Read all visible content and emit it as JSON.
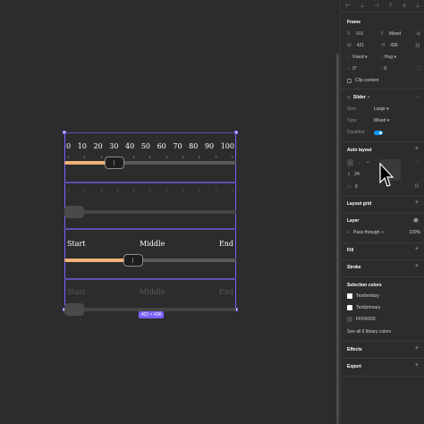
{
  "canvas": {
    "slider1": {
      "numbers": [
        "0",
        "10",
        "20",
        "30",
        "40",
        "50",
        "60",
        "70",
        "80",
        "90",
        "100"
      ],
      "value_fraction": 0.2
    },
    "slider2": {
      "value_fraction": 0.0
    },
    "slider3": {
      "labels": {
        "start": "Start",
        "middle": "Middle",
        "end": "End"
      },
      "value_fraction": 0.4
    },
    "slider4": {
      "labels": {
        "start": "Start",
        "middle": "Middle",
        "end": "End"
      },
      "value_fraction": 0.0
    },
    "size_badge": "421 × 436"
  },
  "panel": {
    "frame": {
      "title": "Frame",
      "x_label": "X",
      "x_value": "-0.5",
      "y_label": "Y",
      "y_value": "Mixed",
      "w_label": "W",
      "w_value": "421",
      "h_label": "H",
      "h_value": "436",
      "width_mode": "Fixed",
      "height_mode": "Hug",
      "rotation": "0°",
      "radius": "0",
      "clip_label": "Clip content"
    },
    "component": {
      "title": "Slider",
      "size_label": "Size",
      "size_value": "Large",
      "type_label": "Type",
      "type_value": "Mixed",
      "disabled_label": "Disabled"
    },
    "auto_layout": {
      "title": "Auto layout",
      "gap": "24",
      "padding": "0"
    },
    "layout_grid": {
      "title": "Layout grid"
    },
    "layer": {
      "title": "Layer",
      "blend": "Pass through",
      "opacity": "100%"
    },
    "fill": {
      "title": "Fill"
    },
    "stroke": {
      "title": "Stroke"
    },
    "selection_colors": {
      "title": "Selection colors",
      "items": [
        {
          "name": "Text/tertiary",
          "color": "#ffffff"
        },
        {
          "name": "Text/primary",
          "color": "#ffffff"
        },
        {
          "name": "FFF8/200",
          "color": "#4a4a4a"
        }
      ],
      "see_all": "See all 6 library colors"
    },
    "effects": {
      "title": "Effects"
    },
    "export": {
      "title": "Export"
    }
  },
  "colors": {
    "accent": "#7b61ff",
    "fill": "#f0b27a",
    "toggle": "#0d99ff"
  }
}
